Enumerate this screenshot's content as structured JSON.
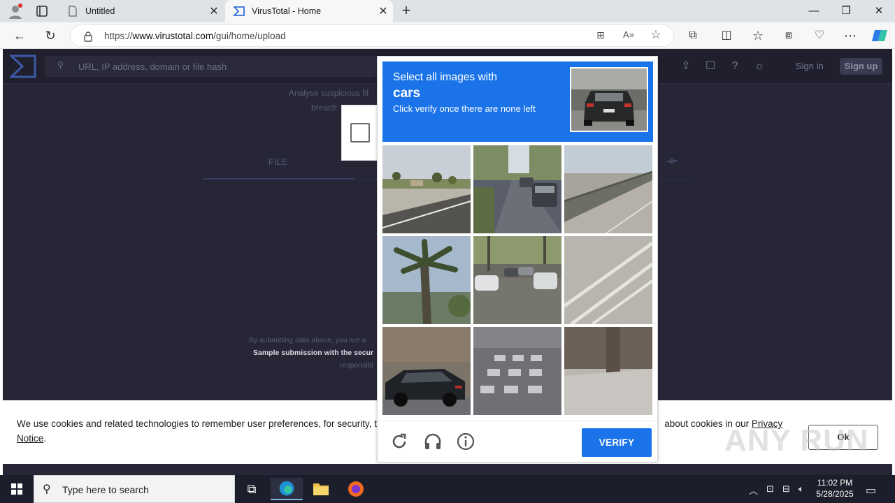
{
  "browser": {
    "tabs": [
      {
        "title": "Untitled",
        "icon": "page-icon"
      },
      {
        "title": "VirusTotal - Home",
        "icon": "virustotal-icon"
      }
    ],
    "url_prefix": "https://",
    "url_domain": "www.virustotal.com",
    "url_path": "/gui/home/upload"
  },
  "virustotal": {
    "search_placeholder": "URL, IP address, domain or file hash",
    "intro_line1": "Analyse suspicious fil",
    "intro_line2": "breach",
    "tab_file": "FILE",
    "disclaimer_line1": "By submitting data above, you are a",
    "disclaimer_line2": "Sample submission with the secur",
    "disclaimer_line3": "responsibl",
    "sign_in": "Sign in",
    "sign_up": "Sign up"
  },
  "cookie": {
    "text_before": "We use cookies and related technologies to remember user preferences, for security, to",
    "text_after": " about cookies in our ",
    "link": "Privacy Notice",
    "end": ".",
    "ok": "Ok"
  },
  "captcha": {
    "line1": "Select all images with",
    "target": "cars",
    "line3": "Click verify once there are none left",
    "verify": "VERIFY",
    "tiles": [
      "road-with-palm-trees",
      "street-with-parked-cars",
      "highway-bridge",
      "palm-tree",
      "parking-lot-cars",
      "road-lane-markings",
      "dark-sedan-car",
      "crosswalk-shadows",
      "sidewalk-wall"
    ],
    "colors": {
      "accent": "#1a73e8"
    }
  },
  "watermark": "ANY RUN",
  "taskbar": {
    "search_placeholder": "Type here to search",
    "time": "11:02 PM",
    "date": "5/28/2025"
  }
}
